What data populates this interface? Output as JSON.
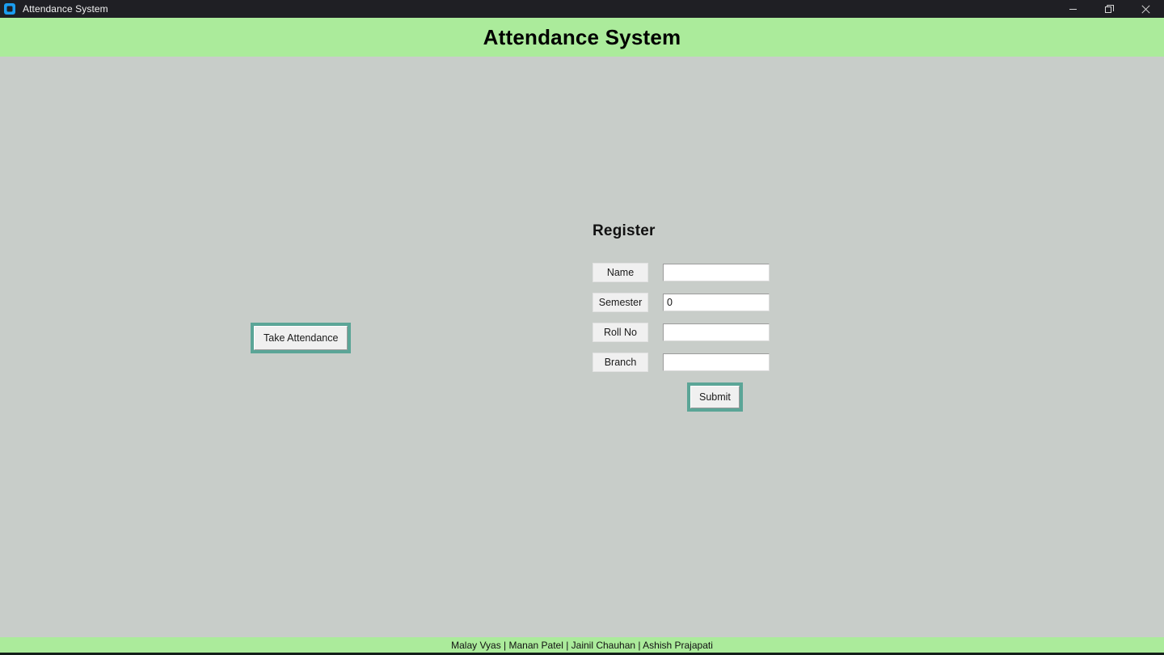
{
  "window": {
    "title": "Attendance System",
    "icon": "app-icon",
    "controls": {
      "minimize": "minimize-icon",
      "restore": "restore-icon",
      "close": "close-icon"
    }
  },
  "header": {
    "title": "Attendance System",
    "background": "#abeb9b"
  },
  "main": {
    "background": "#c8cdc9",
    "take_attendance_label": "Take Attendance",
    "focus_ring_color": "#5ba597",
    "register": {
      "heading": "Register",
      "fields": [
        {
          "label": "Name",
          "value": "",
          "placeholder": ""
        },
        {
          "label": "Semester",
          "value": "0",
          "placeholder": ""
        },
        {
          "label": "Roll No",
          "value": "",
          "placeholder": ""
        },
        {
          "label": "Branch",
          "value": "",
          "placeholder": ""
        }
      ],
      "submit_label": "Submit"
    }
  },
  "footer": {
    "credits": "Malay Vyas | Manan Patel | Jainil Chauhan | Ashish Prajapati",
    "background": "#abeb9b"
  }
}
